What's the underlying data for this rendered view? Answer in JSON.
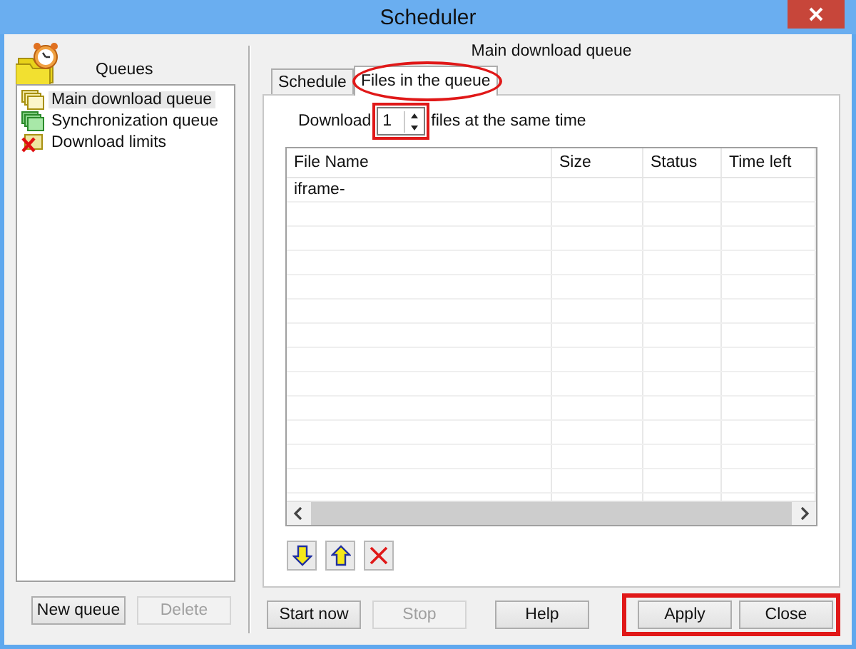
{
  "window": {
    "title": "Scheduler"
  },
  "queues": {
    "label": "Queues",
    "items": [
      {
        "label": "Main download queue",
        "kind": "main",
        "selected": true
      },
      {
        "label": "Synchronization queue",
        "kind": "sync",
        "selected": false
      },
      {
        "label": "Download limits",
        "kind": "limits",
        "selected": false
      }
    ]
  },
  "queue_buttons": [
    {
      "label": "New queue",
      "disabled": false
    },
    {
      "label": "Delete",
      "disabled": true
    }
  ],
  "queue_title": "Main download queue",
  "tabs": [
    {
      "label": "Schedule",
      "selected": false,
      "highlighted": false
    },
    {
      "label": "Files in the queue",
      "selected": true,
      "highlighted": true
    }
  ],
  "download": {
    "label": "Download",
    "value": "1",
    "suffix": "files at the same time",
    "highlighted": true
  },
  "table": {
    "columns": [
      "File Name",
      "Size",
      "Status",
      "Time left"
    ],
    "rows": [
      {
        "file_name": "iframe-"
      }
    ]
  },
  "file_actions": [
    {
      "kind": "down"
    },
    {
      "kind": "up"
    },
    {
      "kind": "delete"
    }
  ],
  "footer_buttons": [
    {
      "label": "Start now",
      "disabled": false
    },
    {
      "label": "Stop",
      "disabled": true
    },
    {
      "label": "Help",
      "disabled": false
    }
  ],
  "dialog_buttons": {
    "highlighted": true,
    "items": [
      {
        "label": "Apply",
        "disabled": false
      },
      {
        "label": "Close",
        "disabled": false
      }
    ]
  }
}
